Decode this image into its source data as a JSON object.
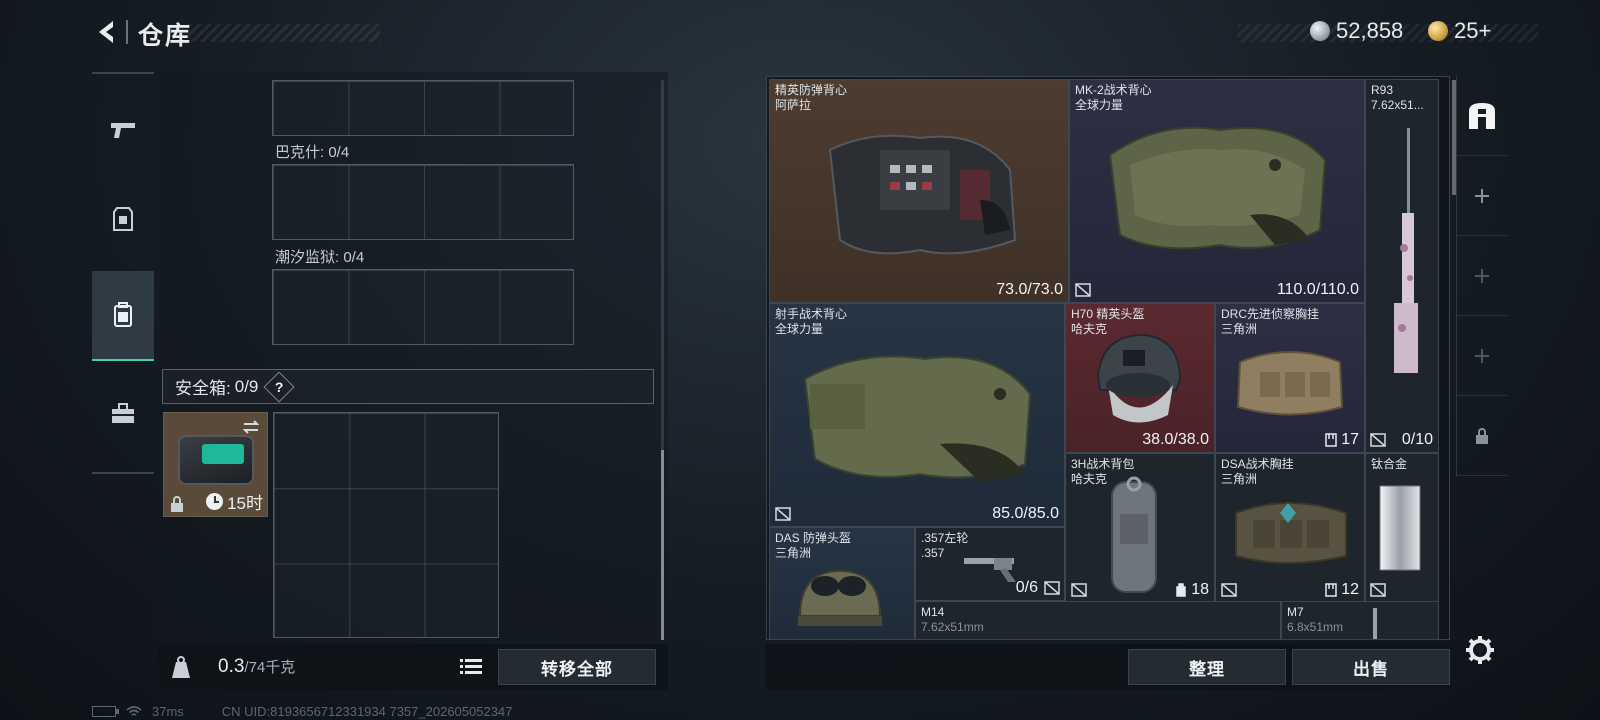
{
  "header": {
    "title": "仓库",
    "currency_silver": "52,858",
    "currency_gold": "25+"
  },
  "rail": {
    "items": [
      {
        "icon": "pistol-icon"
      },
      {
        "icon": "armor-icon"
      },
      {
        "icon": "backpack-icon"
      },
      {
        "icon": "toolbox-icon"
      }
    ]
  },
  "containers": {
    "bakeshi_label": "巴克什: 0/4",
    "chaoxi_label": "潮汐监狱: 0/4",
    "safebox_label": "安全箱:",
    "safebox_count": "0/9",
    "safebox_help": "?",
    "safebox_timer": "15时"
  },
  "footer_left": {
    "weight_value": "0.3",
    "weight_capacity": "/74千克",
    "transfer_all": "转移全部"
  },
  "footer_right": {
    "sort": "整理",
    "sell": "出售"
  },
  "status": {
    "ping": "37ms",
    "uid": "CN UID:8193656712331934 7357_202605052347"
  },
  "stash": {
    "items": [
      {
        "name": "精英防弹背心",
        "sub": "阿萨拉",
        "value": "73.0/73.0"
      },
      {
        "name": "MK-2战术背心",
        "sub": "全球力量",
        "value": "110.0/110.0"
      },
      {
        "name": "R93",
        "sub": "7.62x51...",
        "value": "0/10"
      },
      {
        "name": "射手战术背心",
        "sub": "全球力量",
        "value": "85.0/85.0"
      },
      {
        "name": "H70 精英头盔",
        "sub": "哈夫克",
        "value": "38.0/38.0"
      },
      {
        "name": "DRC先进侦察胸挂",
        "sub": "三角洲",
        "value": "17"
      },
      {
        "name": "3H战术背包",
        "sub": "哈夫克",
        "value": "18"
      },
      {
        "name": "DSA战术胸挂",
        "sub": "三角洲",
        "value": "12"
      },
      {
        "name": "钛合金",
        "sub": "",
        "value": ""
      },
      {
        "name": "DAS 防弹头盔",
        "sub": "三角洲",
        "value": ""
      },
      {
        "name": ".357左轮",
        "sub": ".357",
        "value": "0/6"
      },
      {
        "name": "M14",
        "sub": "7.62x51mm",
        "value": ""
      },
      {
        "name": "M7",
        "sub": "6.8x51mm",
        "value": ""
      }
    ]
  },
  "colors": {
    "accent": "#41d1b0",
    "rarity_brown": "#4d3c30",
    "rarity_purple": "#2f2f44",
    "rarity_blue": "#263444",
    "rarity_red": "#5b2a30"
  }
}
